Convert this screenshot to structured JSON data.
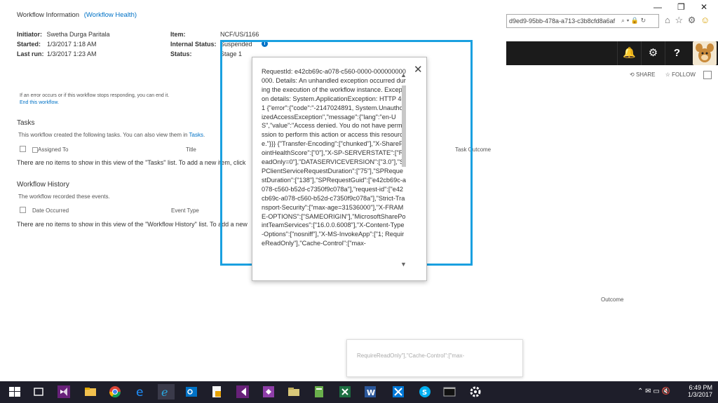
{
  "page": {
    "title": "Workflow Information",
    "health_link": "(Workflow Health)"
  },
  "info": {
    "initiator_label": "Initiator:",
    "initiator": "Swetha Durga Paritala",
    "started_label": "Started:",
    "started": "1/3/2017 1:18 AM",
    "lastrun_label": "Last run:",
    "lastrun": "1/3/2017 1:23 AM",
    "item_label": "Item:",
    "item": "NCF/US/1166",
    "status_label": "Internal Status:",
    "status": "Suspended",
    "stage_label": "Status:",
    "stage": "Stage 1"
  },
  "error_note": {
    "text": "If an error occurs or if this workflow stops responding, you can end it.",
    "end_link": "End this workflow."
  },
  "tasks": {
    "heading": "Tasks",
    "desc_prefix": "This workflow created the following tasks. You can also view them in",
    "desc_link": "Tasks",
    "col_assigned": "Assigned To",
    "col_title": "Title",
    "col_outcome": "Task Outcome",
    "empty": "There are no items to show in this view of the \"Tasks\" list. To add a new item, click"
  },
  "history": {
    "heading": "Workflow History",
    "desc": "The workflow recorded these events.",
    "col_date": "Date Occurred",
    "col_event": "Event Type",
    "col_outcome": "Outcome",
    "empty": "There are no items to show in this view of the \"Workflow History\" list. To add a new"
  },
  "callout": {
    "text": "RequestId: e42cb69c-a078-c560-0000-000000000000. Details: An unhandled exception occurred during the execution of the workflow instance. Exception details: System.ApplicationException: HTTP 401 {\"error\":{\"code\":\"-2147024891, System.UnauthorizedAccessException\",\"message\":{\"lang\":\"en-US\",\"value\":\"Access denied. You do not have permission to perform this action or access this resource.\"}}} {\"Transfer-Encoding\":[\"chunked\"],\"X-SharePointHealthScore\":[\"0\"],\"X-SP-SERVERSTATE\":[\"ReadOnly=0\"],\"DATASERVICEVERSION\":[\"3.0\"],\"SPClientServiceRequestDuration\":[\"75\"],\"SPRequestDuration\":[\"138\"],\"SPRequestGuid\":[\"e42cb69c-a078-c560-b52d-c7350f9c078a\"],\"request-id\":[\"e42cb69c-a078-c560-b52d-c7350f9c078a\"],\"Strict-Transport-Security\":[\"max-age=31536000\"],\"X-FRAME-OPTIONS\":[\"SAMEORIGIN\"],\"MicrosoftSharePointTeamServices\":[\"16.0.0.6008\"],\"X-Content-Type-Options\":[\"nosniff\"],\"X-MS-InvokeApp\":[\"1; RequireReadOnly\"],\"Cache-Control\":[\"max-",
    "close": "✕"
  },
  "ghost": {
    "text": "RequireReadOnly\"],\"Cache-Control\":[\"max-"
  },
  "browser": {
    "url": "d9ed9-95bb-478a-a713-c3b8cfd8a6af",
    "share": "SHARE",
    "follow": "FOLLOW"
  },
  "tray": {
    "time": "6:49 PM",
    "date": "1/3/2017"
  },
  "colors": {
    "highlight": "#1aa0e0",
    "link": "#0072c6",
    "suitebar": "#1b1b1b",
    "taskbar": "#1e1e2a"
  }
}
